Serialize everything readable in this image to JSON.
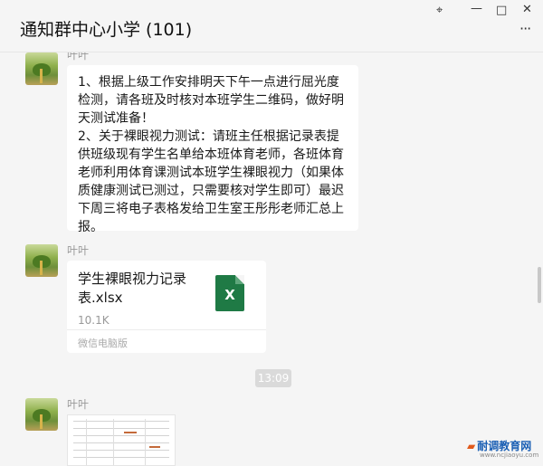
{
  "window": {
    "title": "通知群中心小学 (101)",
    "controls": {
      "pin": "⌖",
      "minimize": "—",
      "maximize": "□",
      "close": "✕",
      "more": "···"
    }
  },
  "messages": [
    {
      "type": "text",
      "sender": "叶叶",
      "text": "1、根据上级工作安排明天下午一点进行屈光度检测，请各班及时核对本班学生二维码，做好明天测试准备！\n2、关于裸眼视力测试：请班主任根据记录表提供班级现有学生名单给本班体育老师，各班体育老师利用体育课测试本班学生裸眼视力（如果体质健康测试已测过，只需要核对学生即可）最迟下周三将电子表格发给卫生室王彤彤老师汇总上报。"
    },
    {
      "type": "file",
      "sender": "叶叶",
      "file_name": "学生裸眼视力记录表.xlsx",
      "file_size": "10.1K",
      "icon_letter": "X",
      "footer": "微信电脑版"
    },
    {
      "type": "timestamp",
      "time": "13:09"
    },
    {
      "type": "image",
      "sender": "叶叶"
    }
  ],
  "watermark": {
    "text": "耐调教育网",
    "url": "www.ncjiaoyu.com"
  },
  "colors": {
    "excel_green": "#1f7a45",
    "background": "#f5f5f5",
    "bubble": "#ffffff"
  }
}
